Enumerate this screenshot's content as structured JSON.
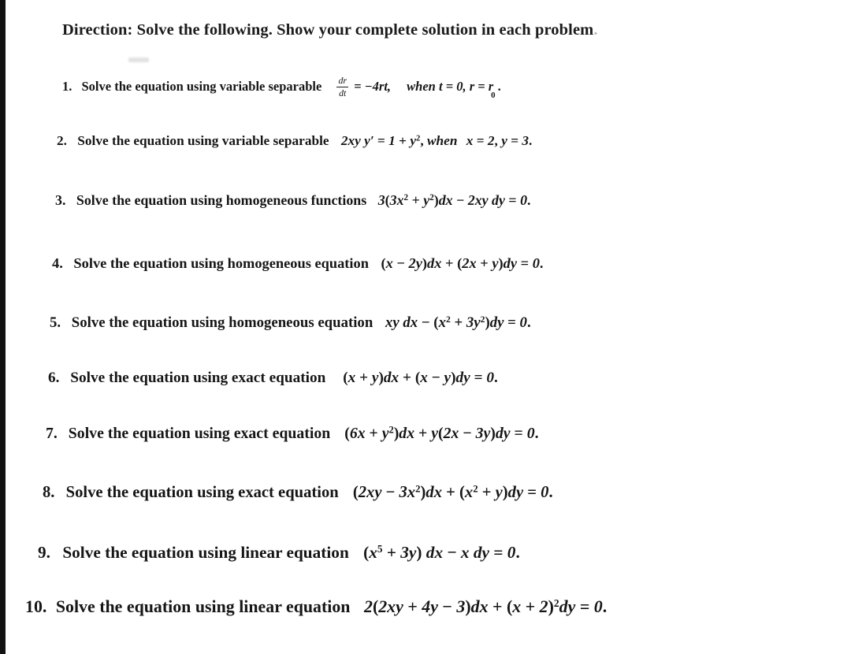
{
  "document": {
    "heading": "Direction: Solve the following. Show your complete solution in each problem",
    "heading_trailing": ".",
    "background_color": "#ffffff",
    "text_color": "#161616",
    "scan_edge_color": "#121212"
  },
  "problems": [
    {
      "number": "1.",
      "stem": "Solve the equation using variable separable",
      "math_prefix": "",
      "fraction": {
        "numerator": "dr",
        "denominator": "dt"
      },
      "equation": "= −4rt,",
      "condition": "when  t = 0,  r = r",
      "subscript": "0",
      "equation_plain": "dr/dt = −4rt, when t = 0, r = r₀"
    },
    {
      "number": "2.",
      "stem": "Solve the equation using variable separable",
      "equation_plain": "2xy y′ = 1 + y², when  x = 2, y = 3."
    },
    {
      "number": "3.",
      "stem": "Solve the equation using homogeneous functions",
      "equation_plain": "3(3x² + y²)dx − 2xy dy = 0."
    },
    {
      "number": "4.",
      "stem": "Solve the equation using homogeneous equation",
      "equation_plain": "(x − 2y)dx + (2x + y)dy = 0."
    },
    {
      "number": "5.",
      "stem": "Solve the equation using homogeneous equation",
      "equation_plain": "xy dx − (x² + 3y²)dy = 0."
    },
    {
      "number": "6.",
      "stem": "Solve the equation using exact equation",
      "equation_plain": "(x + y)dx + (x − y)dy = 0."
    },
    {
      "number": "7.",
      "stem": "Solve the equation using exact equation",
      "equation_plain": "(6x + y²)dx + y(2x − 3y)dy = 0."
    },
    {
      "number": "8.",
      "stem": "Solve the equation using exact equation",
      "equation_plain": "(2xy − 3x²)dx + (x² + y)dy = 0."
    },
    {
      "number": "9.",
      "stem": "Solve the equation using linear equation",
      "equation_plain": "(x⁵ + 3y) dx − x dy = 0."
    },
    {
      "number": "10.",
      "stem": "Solve the equation using linear equation",
      "equation_plain": "2(2xy + 4y − 3)dx + (x + 2)²dy = 0."
    }
  ]
}
